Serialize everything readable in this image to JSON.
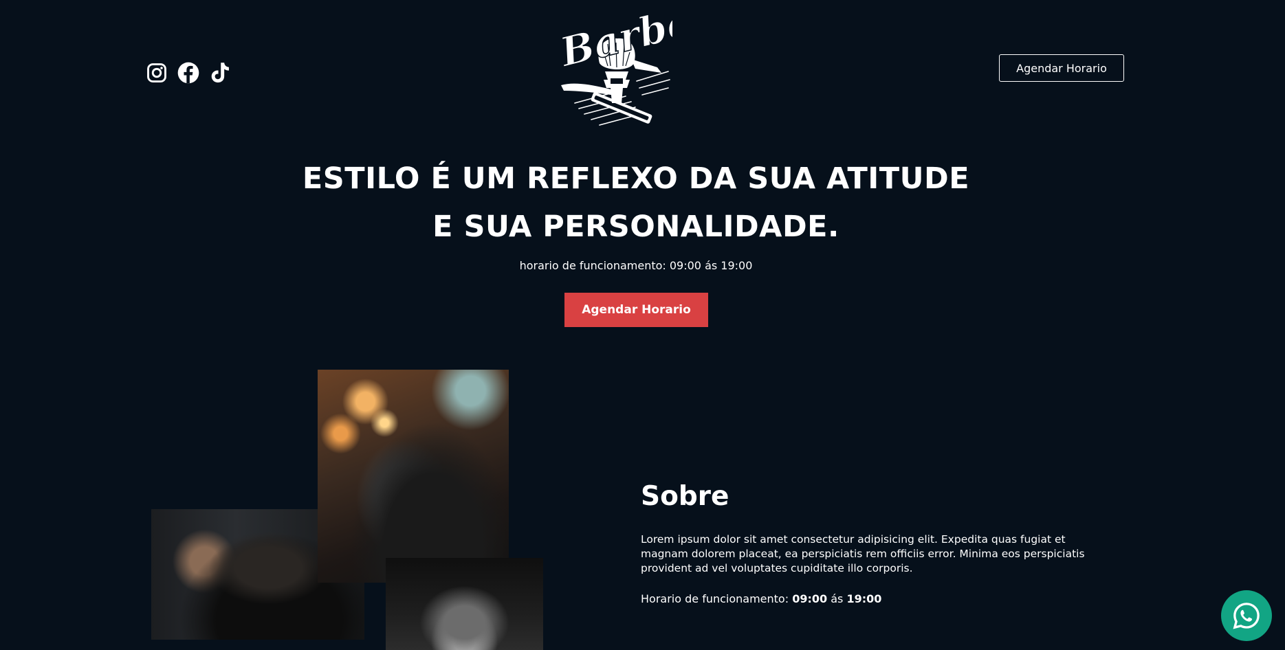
{
  "header": {
    "socials": [
      {
        "icon": "instagram-icon"
      },
      {
        "icon": "facebook-icon"
      },
      {
        "icon": "tiktok-icon"
      }
    ],
    "logo_text": "Barber",
    "cta_label": "Agendar Horario"
  },
  "hero": {
    "title_line1": "ESTILO É UM REFLEXO DA SUA ATITUDE",
    "title_line2": "E SUA PERSONALIDADE.",
    "hours": "horario de funcionamento: 09:00 ás 19:00",
    "cta_label": "Agendar Horario"
  },
  "about": {
    "title": "Sobre",
    "text": "Lorem ipsum dolor sit amet consectetur adipisicing elit. Expedita quas fugiat et magnam dolorem placeat, ea perspiciatis rem officiis error. Minima eos perspiciatis provident ad vel voluptates cupiditate illo corporis.",
    "hours_label": "Horario de funcionamento: ",
    "hours_start": "09:00",
    "hours_sep": " ás ",
    "hours_end": "19:00"
  },
  "colors": {
    "background": "#06101b",
    "accent": "#d94142",
    "whatsapp": "#12a584"
  },
  "floating": {
    "icon": "whatsapp-icon"
  }
}
